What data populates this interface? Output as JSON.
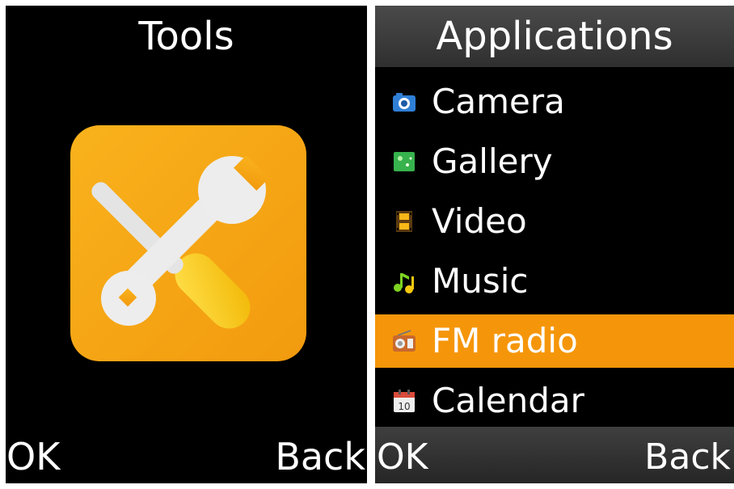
{
  "tools_screen": {
    "title": "Tools",
    "icon": "tools-icon",
    "softkey_left": "OK",
    "softkey_right": "Back"
  },
  "apps_screen": {
    "title": "Applications",
    "items": [
      {
        "label": "Camera",
        "icon": "camera-icon"
      },
      {
        "label": "Gallery",
        "icon": "gallery-icon"
      },
      {
        "label": "Video",
        "icon": "video-icon"
      },
      {
        "label": "Music",
        "icon": "music-icon"
      },
      {
        "label": "FM radio",
        "icon": "radio-icon",
        "selected": true
      },
      {
        "label": "Calendar",
        "icon": "calendar-icon"
      }
    ],
    "softkey_left": "OK",
    "softkey_right": "Back"
  },
  "colors": {
    "screen_bg": "#000000",
    "text": "#ffffff",
    "selection": "#f5960a",
    "tools_icon": "#f5a313"
  }
}
